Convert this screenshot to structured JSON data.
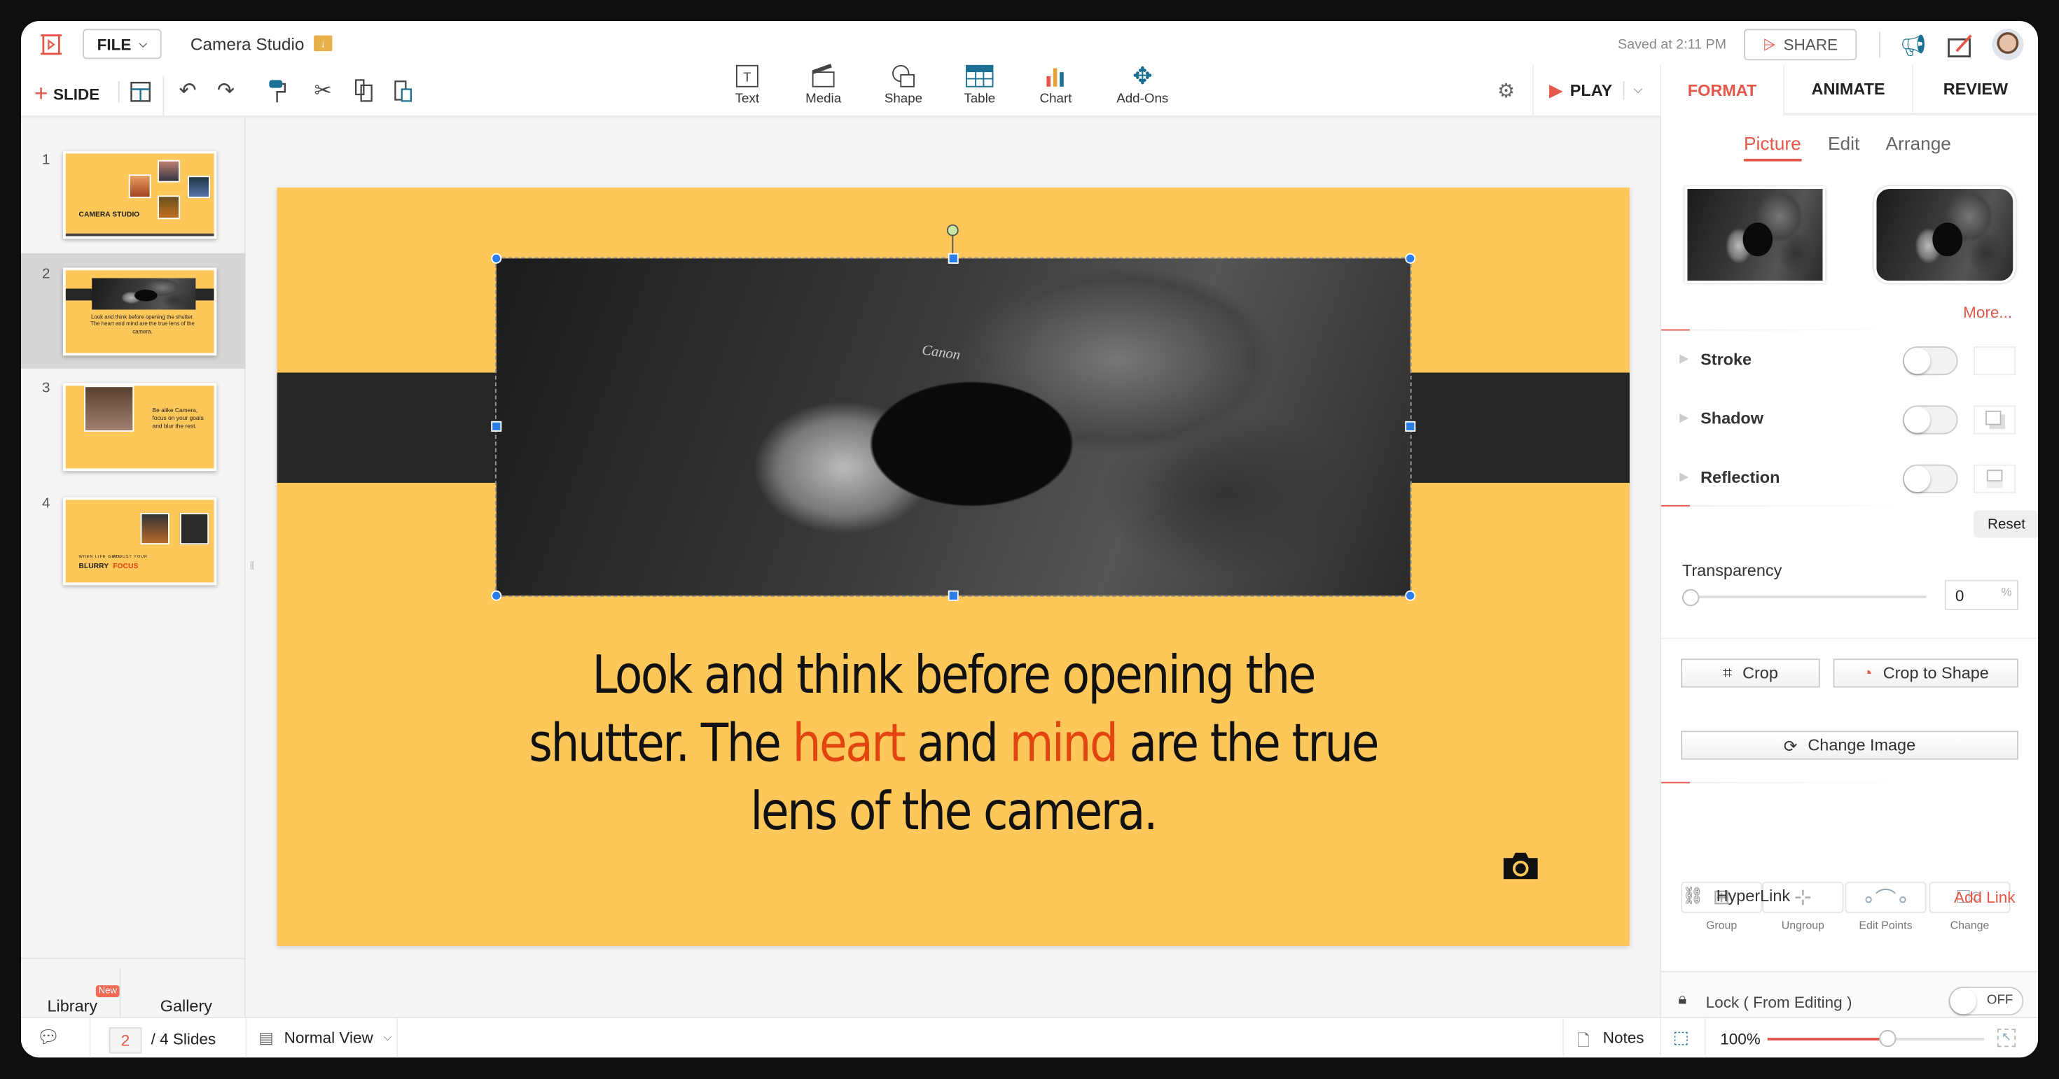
{
  "header": {
    "file_label": "FILE",
    "doc_title": "Camera Studio",
    "saved_status": "Saved at 2:11 PM",
    "share_label": "SHARE"
  },
  "toolbar": {
    "slide_label": "SLIDE",
    "play_label": "PLAY",
    "insert": [
      {
        "label": "Text",
        "icon": "text-box-icon"
      },
      {
        "label": "Media",
        "icon": "media-icon"
      },
      {
        "label": "Shape",
        "icon": "shape-icon"
      },
      {
        "label": "Table",
        "icon": "table-icon"
      },
      {
        "label": "Chart",
        "icon": "chart-icon"
      },
      {
        "label": "Add-Ons",
        "icon": "puzzle-icon"
      }
    ]
  },
  "tabs": [
    {
      "label": "FORMAT",
      "active": true
    },
    {
      "label": "ANIMATE"
    },
    {
      "label": "REVIEW"
    }
  ],
  "slides": {
    "items": [
      {
        "number": "1",
        "title": "CAMERA STUDIO"
      },
      {
        "number": "2",
        "quote": "Look and think before opening the shutter. The heart and mind are the true lens of the camera.",
        "selected": true
      },
      {
        "number": "3",
        "quote": "Be alike Camera, focus on your goals and blur the rest."
      },
      {
        "number": "4",
        "line1": "WHEN LIFE GETS",
        "word1": "BLURRY",
        "line2": "ADJUST YOUR",
        "word2": "FOCUS"
      }
    ]
  },
  "left_footer": {
    "library": "Library",
    "new_badge": "New",
    "gallery": "Gallery"
  },
  "slide": {
    "line1": "Look and think before opening the",
    "line2a": "shutter. The ",
    "heart": "heart",
    "line2b": " and ",
    "mind": "mind",
    "line2c": " are the true",
    "line3": "lens of the camera.",
    "background": "#fec75a",
    "accent": "#e2450f"
  },
  "panel": {
    "subtabs": [
      "Picture",
      "Edit",
      "Arrange"
    ],
    "more": "More...",
    "stroke": "Stroke",
    "shadow": "Shadow",
    "reflection": "Reflection",
    "reset": "Reset",
    "transparency_label": "Transparency",
    "transparency_value": "0",
    "percent": "%",
    "crop": "Crop",
    "crop_to_shape": "Crop to Shape",
    "change_image": "Change Image",
    "shape_actions": [
      "Group",
      "Ungroup",
      "Edit Points",
      "Change"
    ],
    "hyperlink": "HyperLink",
    "add_link": "Add Link",
    "lock": "Lock ( From Editing )",
    "lock_state": "OFF"
  },
  "status": {
    "current_slide": "2",
    "total": "/ 4 Slides",
    "view": "Normal View",
    "notes": "Notes",
    "zoom": "100%",
    "zoom_fraction": 0.55
  },
  "colors": {
    "accent": "#e4574a"
  }
}
